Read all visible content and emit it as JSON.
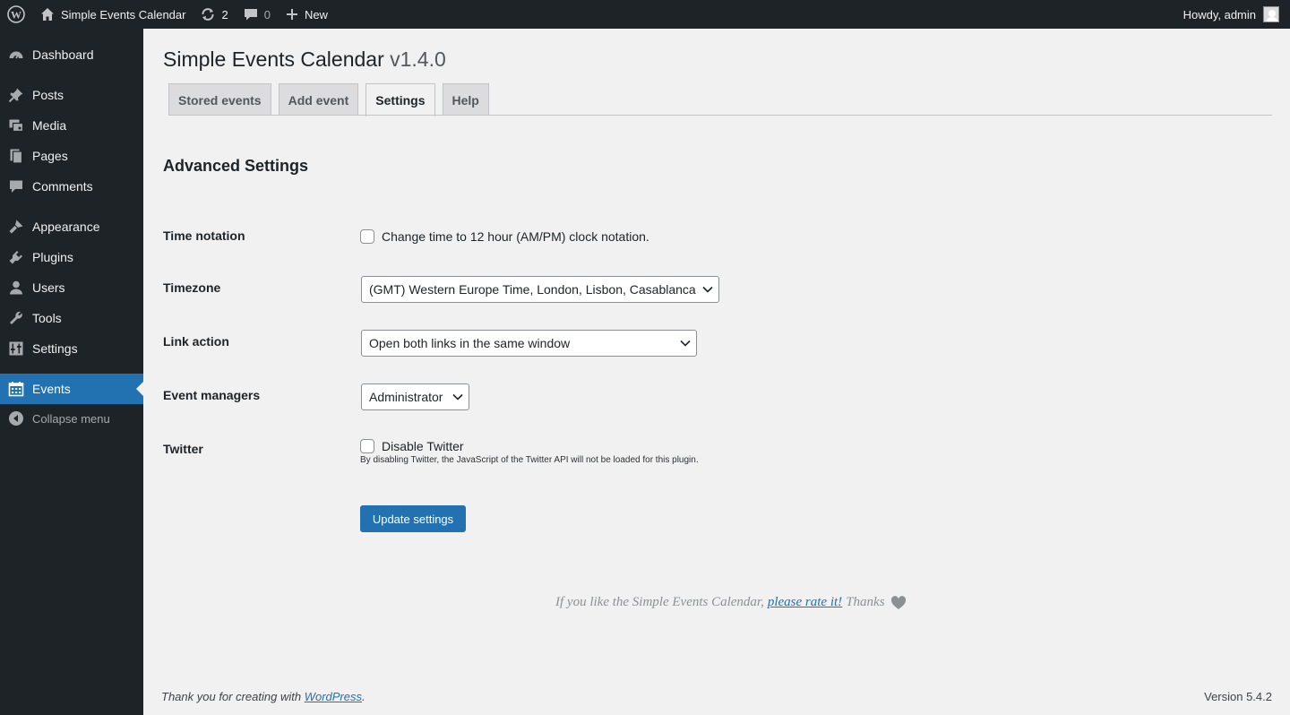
{
  "adminbar": {
    "site_name": "Simple Events Calendar",
    "updates_count": "2",
    "comments_count": "0",
    "new_label": "New",
    "greeting": "Howdy, admin"
  },
  "sidebar": {
    "items": [
      {
        "label": "Dashboard",
        "icon": "dashboard-icon"
      },
      {
        "label": "Posts",
        "icon": "pushpin-icon"
      },
      {
        "label": "Media",
        "icon": "media-icon"
      },
      {
        "label": "Pages",
        "icon": "pages-icon"
      },
      {
        "label": "Comments",
        "icon": "comment-icon"
      },
      {
        "label": "Appearance",
        "icon": "paintbrush-icon"
      },
      {
        "label": "Plugins",
        "icon": "plugin-icon"
      },
      {
        "label": "Users",
        "icon": "user-icon"
      },
      {
        "label": "Tools",
        "icon": "wrench-icon"
      },
      {
        "label": "Settings",
        "icon": "sliders-icon"
      },
      {
        "label": "Events",
        "icon": "calendar-icon",
        "current": true
      },
      {
        "label": "Collapse menu",
        "icon": "collapse-icon"
      }
    ]
  },
  "page": {
    "title": "Simple Events Calendar",
    "version": "v1.4.0",
    "tabs": [
      {
        "label": "Stored events"
      },
      {
        "label": "Add event"
      },
      {
        "label": "Settings",
        "active": true
      },
      {
        "label": "Help"
      }
    ],
    "section_title": "Advanced Settings"
  },
  "settings": {
    "time_notation": {
      "label": "Time notation",
      "checkbox_label": "Change time to 12 hour (AM/PM) clock notation.",
      "checked": false
    },
    "timezone": {
      "label": "Timezone",
      "value": "(GMT) Western Europe Time, London, Lisbon, Casablanca"
    },
    "link_action": {
      "label": "Link action",
      "value": "Open both links in the same window"
    },
    "event_managers": {
      "label": "Event managers",
      "value": "Administrator"
    },
    "twitter": {
      "label": "Twitter",
      "checkbox_label": "Disable Twitter",
      "description": "By disabling Twitter, the JavaScript of the Twitter API will not be loaded for this plugin.",
      "checked": false
    },
    "update_button": "Update settings"
  },
  "rate": {
    "prefix": "If you like the Simple Events Calendar,",
    "link": "please rate it!",
    "suffix": "Thanks"
  },
  "footer": {
    "thanks_prefix": "Thank you for creating with",
    "thanks_link": "WordPress",
    "thanks_suffix": ".",
    "version": "Version 5.4.2"
  },
  "colors": {
    "adminbar_bg": "#1d2327",
    "accent": "#2271b1",
    "page_bg": "#f1f1f1"
  }
}
